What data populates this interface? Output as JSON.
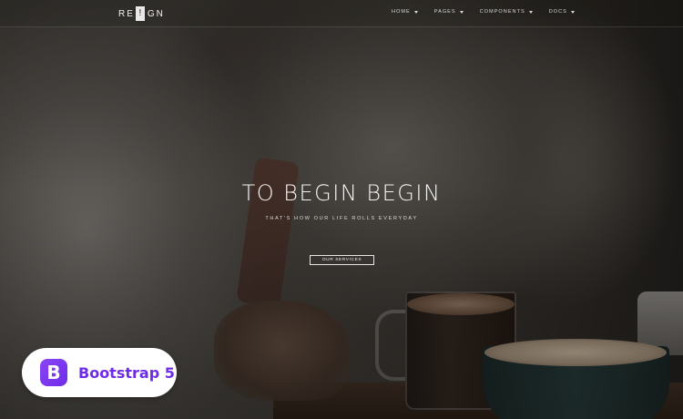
{
  "brand": {
    "text_left": "RE",
    "mark": "!",
    "text_right": "GN"
  },
  "nav": {
    "items": [
      {
        "label": "HOME",
        "icon": "caret-down-icon"
      },
      {
        "label": "PAGES",
        "icon": "caret-down-icon"
      },
      {
        "label": "COMPONENTS",
        "icon": "caret-down-icon"
      },
      {
        "label": "DOCS",
        "icon": "caret-down-icon"
      }
    ]
  },
  "hero": {
    "title": "TO BEGIN BEGIN",
    "subtitle": "THAT'S HOW OUR LIFE ROLLS EVERYDAY",
    "cta_label": "OUR SERVICES"
  },
  "badge": {
    "icon_letter": "B",
    "label": "Bootstrap 5",
    "accent": "#6f2ce8"
  }
}
